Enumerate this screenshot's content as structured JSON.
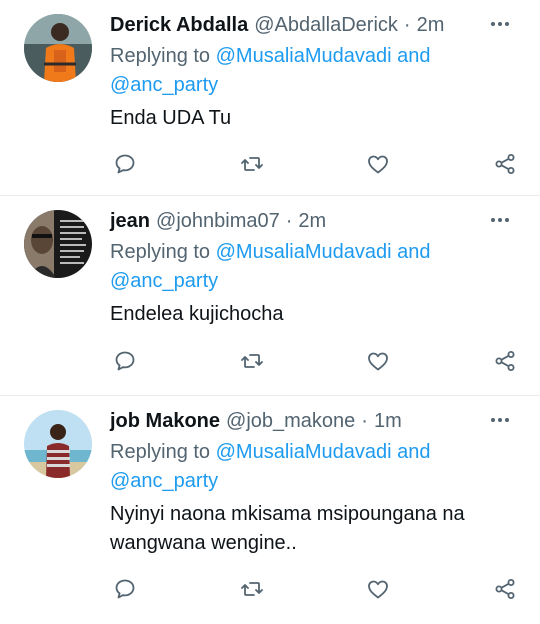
{
  "tweets": [
    {
      "name": "Derick Abdalla",
      "handle": "@AbdallaDerick",
      "separator": "·",
      "time": "2m",
      "replying_prefix": "Replying to",
      "mention1": "@MusaliaMudavadi",
      "and": "and",
      "mention2": "@anc_party",
      "text": "Enda UDA Tu",
      "avatar_icon": "avatar-orange-lifejacket"
    },
    {
      "name": "jean",
      "handle": "@johnbima07",
      "separator": "·",
      "time": "2m",
      "replying_prefix": "Replying to",
      "mention1": "@MusaliaMudavadi",
      "and": "and",
      "mention2": "@anc_party",
      "text": "Endelea kujichocha",
      "avatar_icon": "avatar-portrait-quote"
    },
    {
      "name": "job Makone",
      "handle": "@job_makone",
      "separator": "·",
      "time": "1m",
      "replying_prefix": "Replying to",
      "mention1": "@MusaliaMudavadi",
      "and": "and",
      "mention2": "@anc_party",
      "text": "Nyinyi naona mkisama msipoungana na wangwana wengine..",
      "avatar_icon": "avatar-beach-person"
    }
  ],
  "icons": {
    "reply": "reply-icon",
    "retweet": "retweet-icon",
    "like": "like-icon",
    "share": "share-icon",
    "more": "more-icon"
  },
  "colors": {
    "link": "#1d9bf0",
    "secondary": "#536471",
    "primary": "#0f1419",
    "divider": "#e6ecf0"
  }
}
